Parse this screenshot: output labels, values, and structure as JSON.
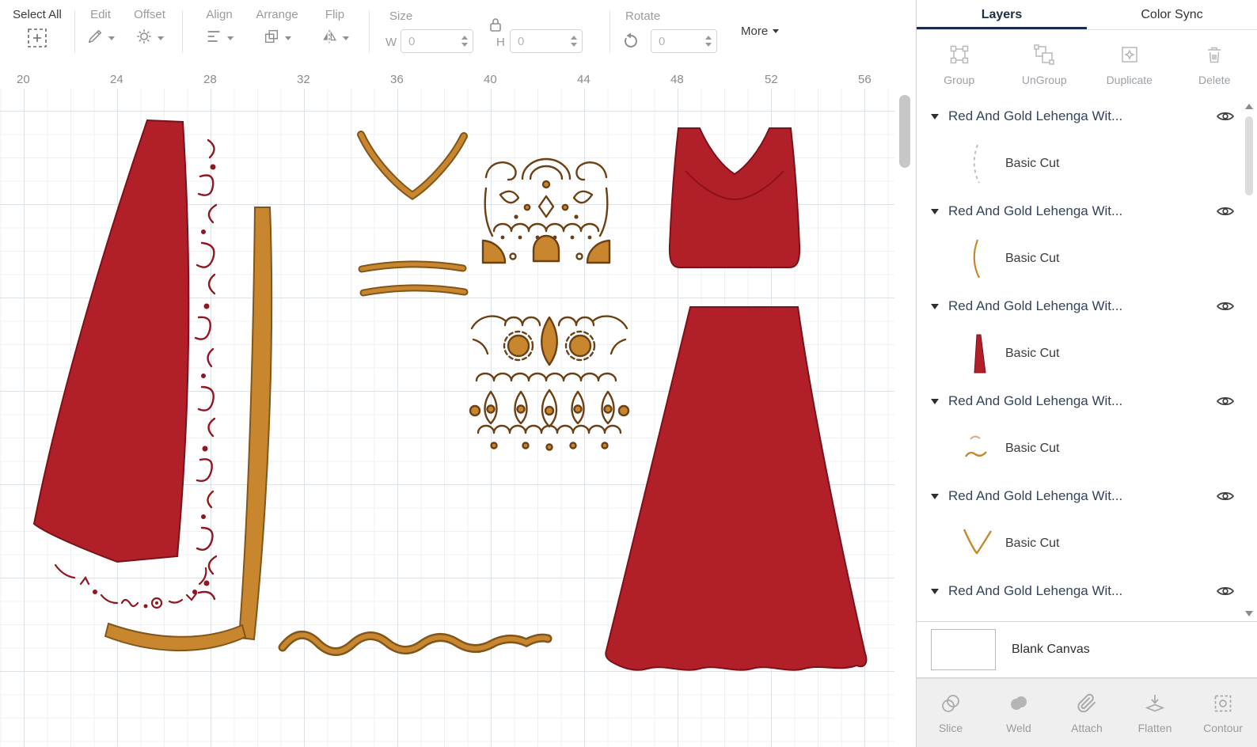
{
  "toolbar": {
    "select_all_label": "Select All",
    "edit_label": "Edit",
    "offset_label": "Offset",
    "align_label": "Align",
    "arrange_label": "Arrange",
    "flip_label": "Flip",
    "size_label": "Size",
    "width_label": "W",
    "width_value": "0",
    "height_label": "H",
    "height_value": "0",
    "rotate_label": "Rotate",
    "rotate_value": "0",
    "more_label": "More"
  },
  "ruler": {
    "ticks": [
      "20",
      "24",
      "28",
      "32",
      "36",
      "40",
      "44",
      "48",
      "52",
      "56"
    ]
  },
  "panel": {
    "tabs": {
      "layers": "Layers",
      "color_sync": "Color Sync"
    },
    "actions": {
      "group": "Group",
      "ungroup": "UnGroup",
      "duplicate": "Duplicate",
      "delete": "Delete"
    },
    "layers": [
      {
        "title": "Red And Gold Lehenga Wit...",
        "type": "Basic Cut"
      },
      {
        "title": "Red And Gold Lehenga Wit...",
        "type": "Basic Cut"
      },
      {
        "title": "Red And Gold Lehenga Wit...",
        "type": "Basic Cut"
      },
      {
        "title": "Red And Gold Lehenga Wit...",
        "type": "Basic Cut"
      },
      {
        "title": "Red And Gold Lehenga Wit...",
        "type": "Basic Cut"
      },
      {
        "title": "Red And Gold Lehenga Wit...",
        "type": "Basic Cut"
      }
    ],
    "blank_canvas_label": "Blank Canvas",
    "footer": {
      "slice": "Slice",
      "weld": "Weld",
      "attach": "Attach",
      "flatten": "Flatten",
      "contour": "Contour"
    }
  },
  "colors": {
    "red": "#b11f29",
    "red_stroke": "#7c1119",
    "gold": "#c8872e",
    "gold_stroke": "#81561a",
    "ornament_brown": "#6b4015",
    "lace_maroon": "#8e1722",
    "active_tab_underline": "#1c2b4a"
  }
}
